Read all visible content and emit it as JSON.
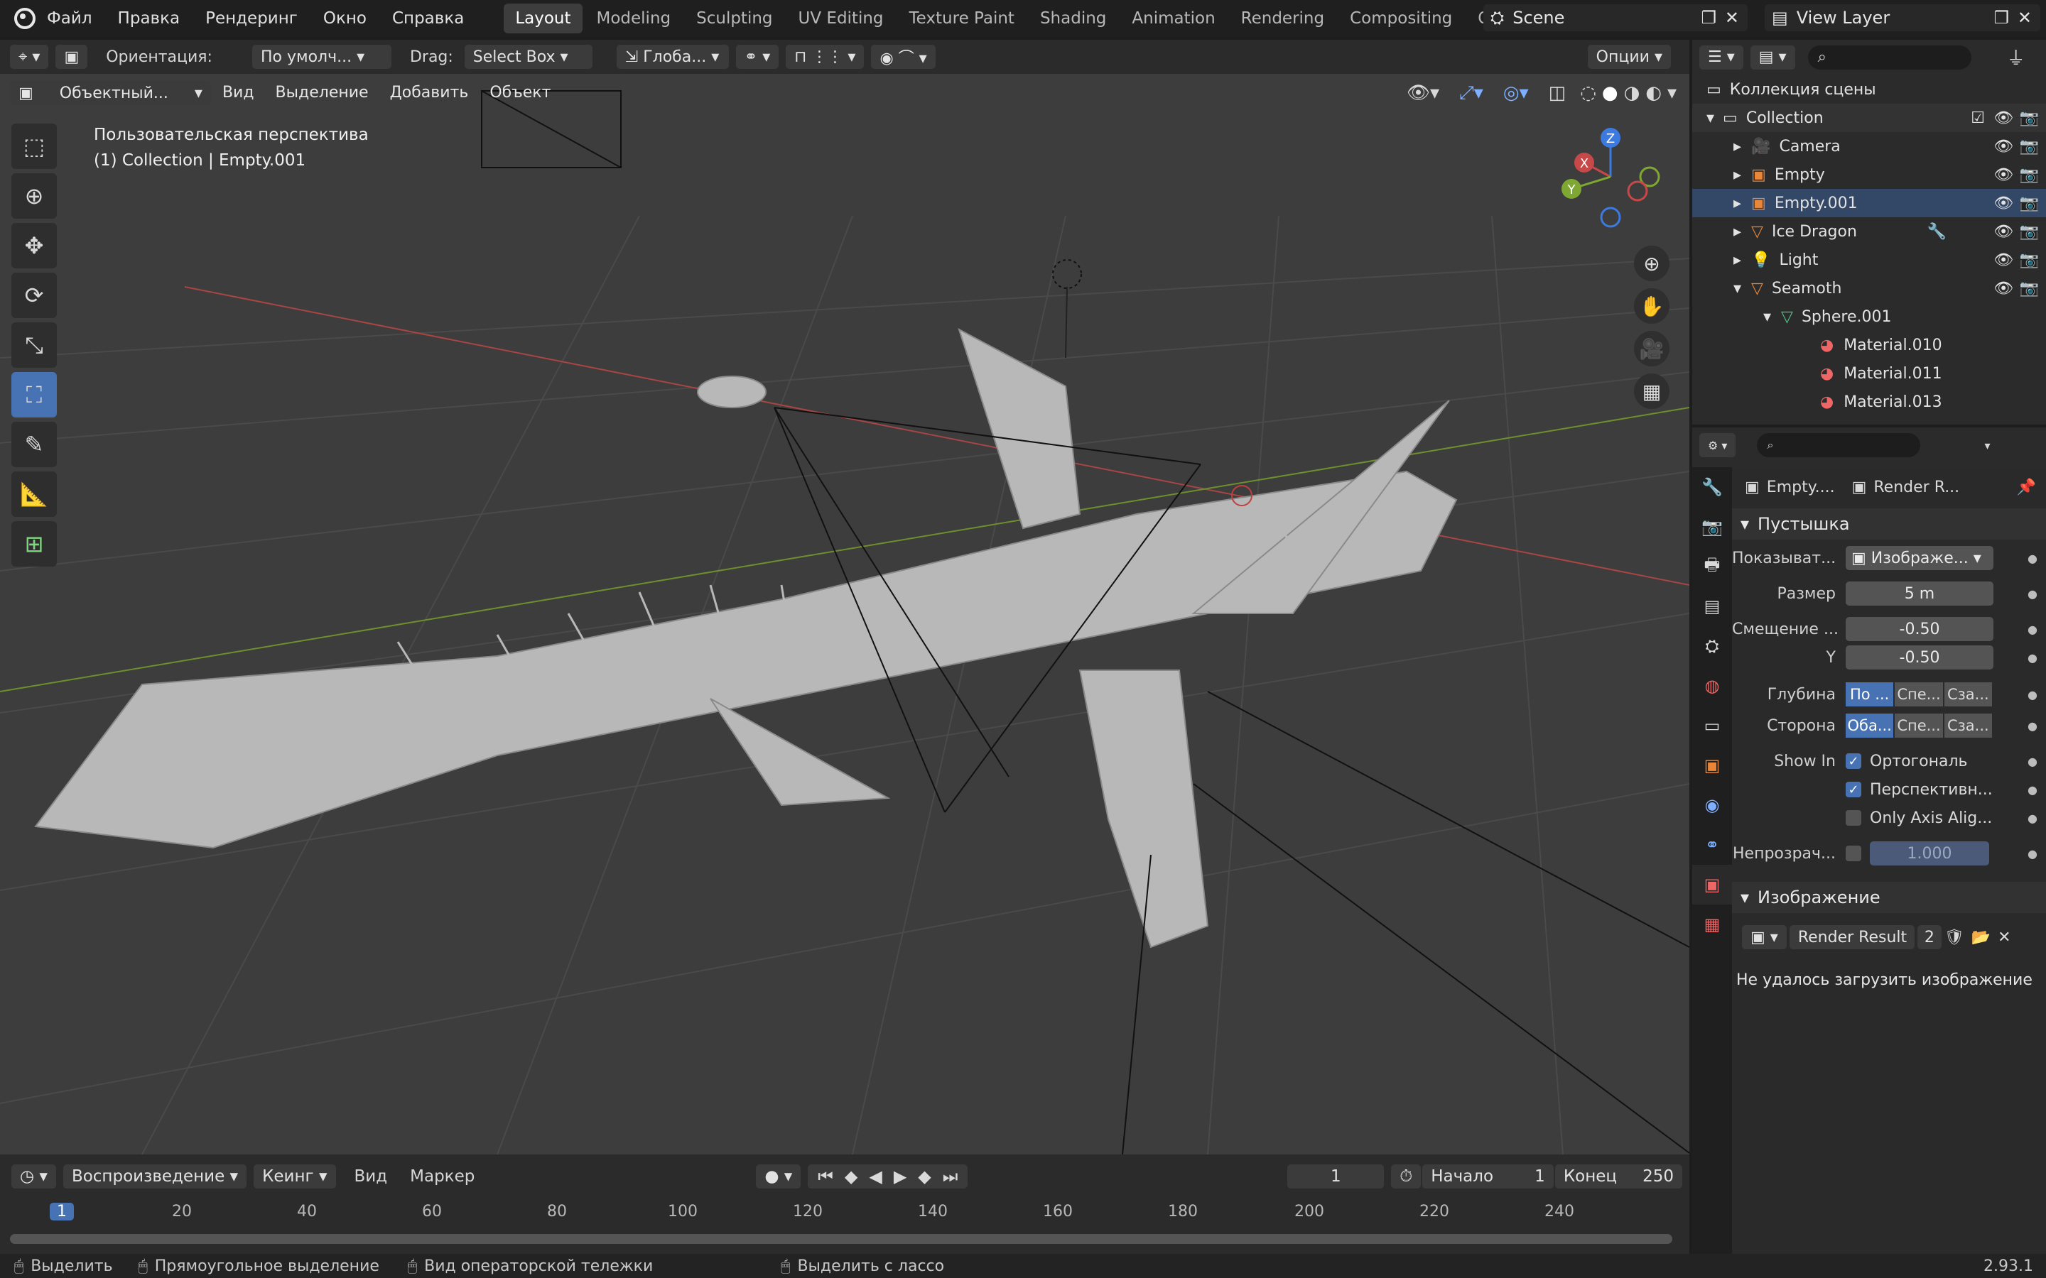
{
  "topbar": {
    "menus": [
      "Файл",
      "Правка",
      "Рендеринг",
      "Окно",
      "Справка"
    ],
    "workspaces": [
      "Layout",
      "Modeling",
      "Sculpting",
      "UV Editing",
      "Texture Paint",
      "Shading",
      "Animation",
      "Rendering",
      "Compositing",
      "Geometry"
    ],
    "active_workspace": "Layout",
    "scene": "Scene",
    "view_layer": "View Layer"
  },
  "header": {
    "orientation_label": "Ориентация:",
    "orientation_value": "По умолч...",
    "drag_label": "Drag:",
    "drag_value": "Select Box",
    "transform_value": "Глоба...",
    "options": "Опции"
  },
  "viewport": {
    "mode": "Объектный...",
    "menu": [
      "Вид",
      "Выделение",
      "Добавить",
      "Объект"
    ],
    "overlay_line1": "Пользовательская перспектива",
    "overlay_line2": "(1) Collection | Empty.001",
    "gizmo": {
      "x": "X",
      "y": "Y",
      "z": "Z"
    },
    "colors": {
      "background": "#3d3d3d",
      "x_axis": "#c74848",
      "y_axis": "#7ea832",
      "z_axis": "#3c7ae0",
      "model": "#bdbdbd"
    }
  },
  "timeline": {
    "playback": "Воспроизведение",
    "keying": "Кеинг",
    "view": "Вид",
    "marker": "Маркер",
    "current_frame": "1",
    "start_label": "Начало",
    "start": "1",
    "end_label": "Конец",
    "end": "250",
    "ticks": [
      "1",
      "20",
      "40",
      "60",
      "80",
      "100",
      "120",
      "140",
      "160",
      "180",
      "200",
      "220",
      "240"
    ]
  },
  "status": {
    "select": "Выделить",
    "box_select": "Прямоугольное выделение",
    "dolly": "Вид операторской тележки",
    "lasso": "Выделить с лассо",
    "version": "2.93.1"
  },
  "outliner": {
    "root": "Коллекция сцены",
    "collection": "Collection",
    "items": [
      {
        "name": "Camera",
        "icon": "camera-icon",
        "color": "#e8873a"
      },
      {
        "name": "Empty",
        "icon": "empty-icon",
        "color": "#e8873a"
      },
      {
        "name": "Empty.001",
        "icon": "empty-icon",
        "color": "#e8873a"
      },
      {
        "name": "Ice Dragon",
        "icon": "mesh-icon",
        "color": "#e8873a"
      },
      {
        "name": "Light",
        "icon": "light-icon",
        "color": "#e8873a"
      },
      {
        "name": "Seamoth",
        "icon": "mesh-icon",
        "color": "#e8873a"
      }
    ],
    "sphere": "Sphere.001",
    "materials": [
      "Material.010",
      "Material.011",
      "Material.013"
    ]
  },
  "properties": {
    "object": "Empty....",
    "data": "Render R...",
    "section_empty": "Пустышка",
    "display_label": "Показыват...",
    "display_value": "Изображе...",
    "size_label": "Размер",
    "size": "5 m",
    "offset_label": "Смещение ...",
    "offset_x": "-0.50",
    "y_label": "Y",
    "offset_y": "-0.50",
    "depth_label": "Глубина",
    "depth": [
      "По ...",
      "Спе...",
      "Сза..."
    ],
    "side_label": "Сторона",
    "side": [
      "Оба...",
      "Спе...",
      "Сза..."
    ],
    "show_in_label": "Show In",
    "show_ortho": "Ортогональ",
    "show_persp": "Перспективн...",
    "only_axis": "Only Axis Alig...",
    "opacity_label": "Непрозрач...",
    "opacity": "1.000",
    "section_image": "Изображение",
    "image_name": "Render Result",
    "image_users": "2",
    "error": "Не удалось загрузить изображение"
  }
}
